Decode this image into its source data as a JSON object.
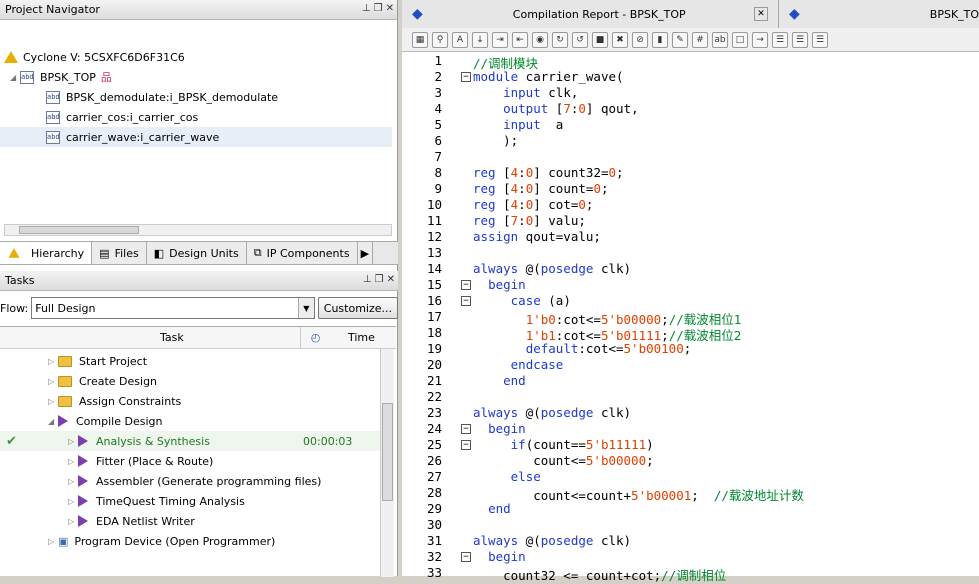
{
  "navigator": {
    "title": "Project Navigator",
    "device": "Cyclone V: 5CSXFC6D6F31C6",
    "top": "BPSK_TOP",
    "children": [
      "BPSK_demodulate:i_BPSK_demodulate",
      "carrier_cos:i_carrier_cos",
      "carrier_wave:i_carrier_wave"
    ],
    "tabs": [
      "Hierarchy",
      "Files",
      "Design Units",
      "IP Components"
    ]
  },
  "tasks": {
    "title": "Tasks",
    "flow_label": "Flow:",
    "flow_value": "Full Design",
    "customize": "Customize...",
    "col_task": "Task",
    "col_time": "Time",
    "rows": [
      {
        "label": "Start Project",
        "time": ""
      },
      {
        "label": "Create Design",
        "time": ""
      },
      {
        "label": "Assign Constraints",
        "time": ""
      },
      {
        "label": "Compile Design",
        "time": ""
      },
      {
        "label": "Analysis & Synthesis",
        "time": "00:00:03"
      },
      {
        "label": "Fitter (Place & Route)",
        "time": ""
      },
      {
        "label": "Assembler (Generate programming files)",
        "time": ""
      },
      {
        "label": "TimeQuest Timing Analysis",
        "time": ""
      },
      {
        "label": "EDA Netlist Writer",
        "time": ""
      },
      {
        "label": "Program Device (Open Programmer)",
        "time": ""
      }
    ]
  },
  "editor": {
    "tab1": "Compilation Report - BPSK_TOP",
    "tab2": "BPSK_TO",
    "lines": [
      "//调制模块",
      "module carrier_wave(",
      "    input clk,",
      "    output [7:0] qout,",
      "    input  a",
      "    );",
      "",
      "reg [4:0] count32=0;",
      "reg [4:0] count=0;",
      "reg [4:0] cot=0;",
      "reg [7:0] valu;",
      "assign qout=valu;",
      "",
      "always @(posedge clk)",
      "  begin",
      "     case (a)",
      "       1'b0:cot<=5'b00000;//载波相位1",
      "       1'b1:cot<=5'b01111;//载波相位2",
      "       default:cot<=5'b00100;",
      "     endcase",
      "    end",
      "",
      "always @(posedge clk)",
      "  begin",
      "     if(count==5'b11111)",
      "        count<=5'b00000;",
      "     else",
      "        count<=count+5'b00001;  //载波地址计数",
      "  end",
      "",
      "always @(posedge clk)",
      "  begin",
      "    count32 <= count+cot;//调制相位"
    ]
  }
}
